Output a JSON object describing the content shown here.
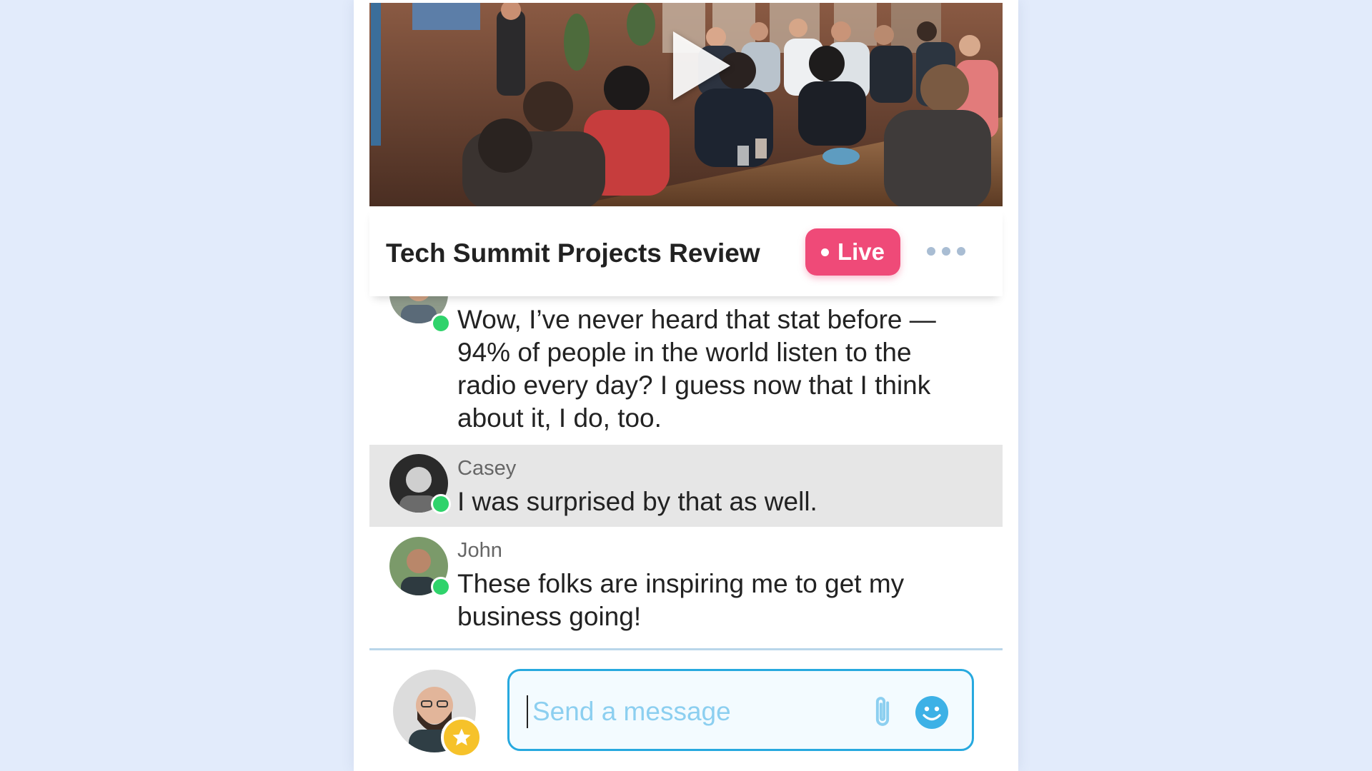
{
  "video": {
    "title": "Tech Summit Projects Review",
    "live_label": "Live",
    "play_icon": "play-icon",
    "more_icon": "more-horizontal-icon"
  },
  "messages": [
    {
      "name": "",
      "text": "Wow, I’ve never heard that stat before — 94% of people in the world listen to the radio every day? I guess now that I think about it, I do, too.",
      "online": true,
      "highlighted": false
    },
    {
      "name": "Casey",
      "text": "I was surprised by that as well.",
      "online": true,
      "highlighted": true
    },
    {
      "name": "John",
      "text": "These folks are inspiring me to get my business going!",
      "online": true,
      "highlighted": false
    }
  ],
  "composer": {
    "placeholder": "Send a message",
    "attach_icon": "paperclip-icon",
    "emoji_icon": "smiley-icon",
    "user_badge_icon": "star-icon"
  },
  "colors": {
    "background": "#e2ebfb",
    "live": "#ef4a78",
    "online": "#2fd36b",
    "accent": "#27a9df",
    "badge": "#f6c22a",
    "highlight_row": "#e6e6e6"
  }
}
